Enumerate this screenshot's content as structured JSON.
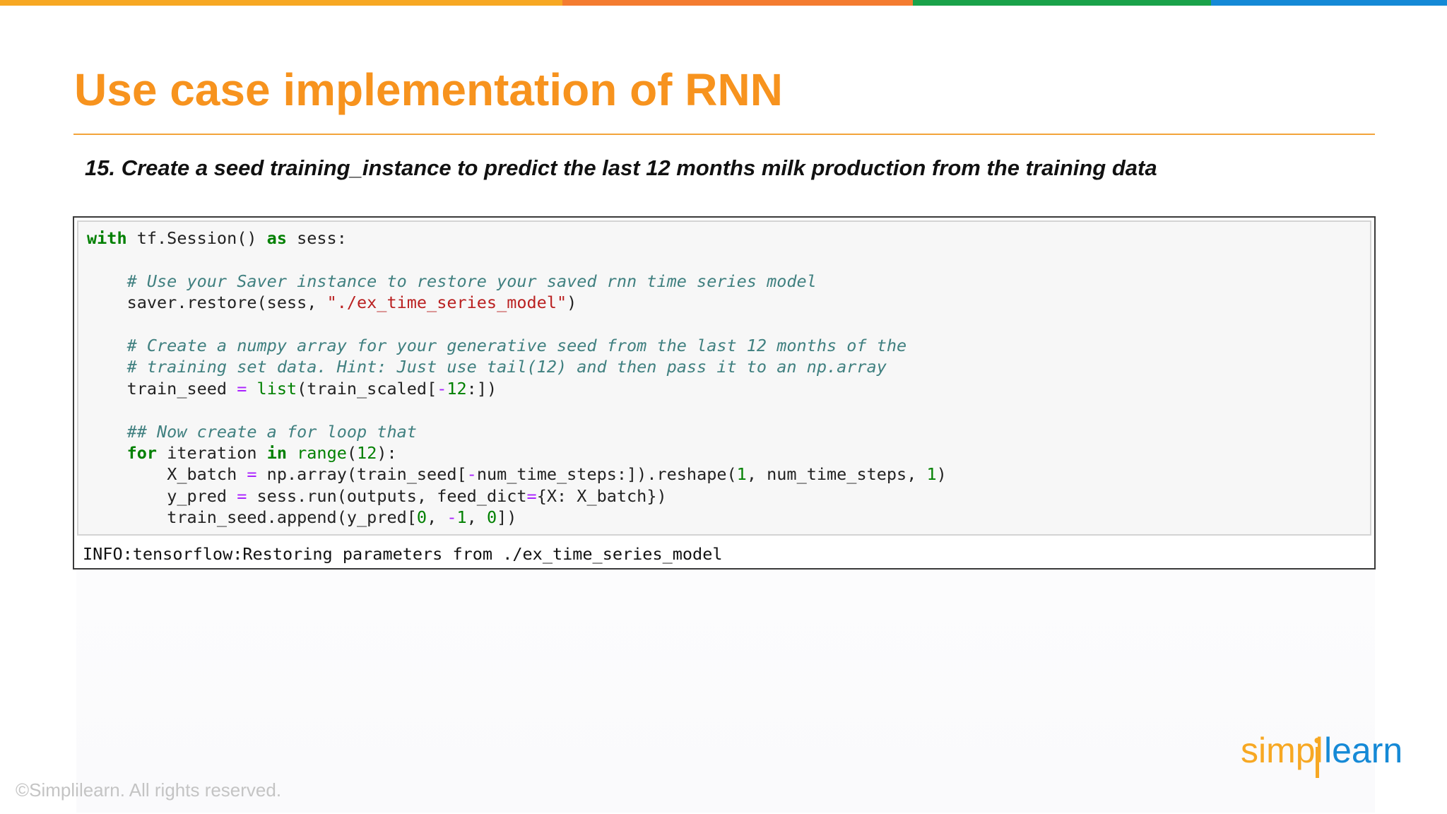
{
  "slide": {
    "title": "Use case implementation of RNN",
    "step": "15. Create a seed training_instance to predict the last 12 months milk production from the training data"
  },
  "notebook": {
    "code": {
      "l1_with": "with",
      "l1_rest": " tf.Session() ",
      "l1_as": "as",
      "l1_end": " sess:",
      "l3_comment": "# Use your Saver instance to restore your saved rnn time series model",
      "l4_pre": "saver.restore(sess, ",
      "l4_str": "\"./ex_time_series_model\"",
      "l4_post": ")",
      "l6_comment": "# Create a numpy array for your generative seed from the last 12 months of the",
      "l7_comment": "# training set data. Hint: Just use tail(12) and then pass it to an np.array",
      "l8_pre": "train_seed ",
      "l8_eq": "=",
      "l8_sp": " ",
      "l8_list": "list",
      "l8_mid": "(train_scaled[",
      "l8_minus": "-",
      "l8_num": "12",
      "l8_post": ":])",
      "l10_comment": "## Now create a for loop that",
      "l11_for": "for",
      "l11_mid": " iteration ",
      "l11_in": "in",
      "l11_sp": " ",
      "l11_range": "range",
      "l11_open": "(",
      "l11_num": "12",
      "l11_close": "):",
      "l12_pre": "X_batch ",
      "l12_eq": "=",
      "l12_mid1": " np.array(train_seed[",
      "l12_minus": "-",
      "l12_mid2": "num_time_steps:]).reshape(",
      "l12_n1": "1",
      "l12_mid3": ", num_time_steps, ",
      "l12_n2": "1",
      "l12_post": ")",
      "l13_pre": "y_pred ",
      "l13_eq": "=",
      "l13_mid": " sess.run(outputs, feed_dict",
      "l13_eq2": "=",
      "l13_post": "{X: X_batch})",
      "l14_pre": "train_seed.append(y_pred[",
      "l14_n0": "0",
      "l14_c1": ", ",
      "l14_minus": "-",
      "l14_n1": "1",
      "l14_c2": ", ",
      "l14_n2": "0",
      "l14_post": "])"
    },
    "output": "INFO:tensorflow:Restoring parameters from ./ex_time_series_model"
  },
  "footer": {
    "copyright": "©Simplilearn. All rights reserved.",
    "logo_text": "simplilearn"
  },
  "colors": {
    "title": "#f7931e",
    "bar": [
      "#f7a823",
      "#f47c30",
      "#1aa24a",
      "#1589d6"
    ],
    "logo_simpl": "#f7a823",
    "logo_learn": "#1589d6"
  }
}
